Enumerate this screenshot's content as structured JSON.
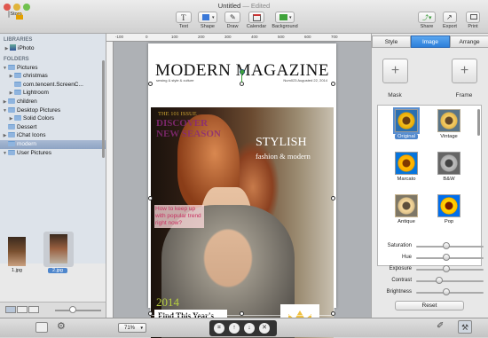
{
  "window": {
    "title": "Untitled",
    "edited": "— Edited"
  },
  "toolbar": {
    "store": "Store",
    "items": [
      "Text",
      "Shape",
      "Draw",
      "Calendar",
      "Background"
    ],
    "right": [
      "Share",
      "Export",
      "Print"
    ]
  },
  "sidebar": {
    "libraries_header": "LIBRARIES",
    "iphoto": "iPhoto",
    "folders_header": "FOLDERS",
    "folders": [
      "Pictures",
      "christmas",
      "com.tencent.ScreenC...",
      "Lightroom",
      "children",
      "Desktop Pictures",
      "Solid Colors",
      "Dessert",
      "iChat Icons",
      "modern",
      "User Pictures"
    ],
    "thumbs": [
      "1.jpg",
      "2.jpg"
    ]
  },
  "ruler": {
    "labels": [
      "-100",
      "0",
      "100",
      "200",
      "300",
      "400",
      "500",
      "600",
      "700"
    ]
  },
  "magazine": {
    "title": "MODERN MAGAZINE",
    "subtitle_left": "sewing & style & culture",
    "subtitle_right": "Num023 Augusted 22, 2014",
    "issue": "THE 101 ISSUE",
    "discover": "DISCOVER",
    "new_season": "NEW SEASON",
    "stylish": "STYLISH",
    "fashion": "fashion & modern",
    "keep_up": "How to keep up with popular trend right now?",
    "year": "2014",
    "find": "Find This Year's",
    "find_sub": "fashion products by yourselves and our guide"
  },
  "zoom": "71%",
  "panel": {
    "tabs": [
      "Style",
      "Image",
      "Arrange"
    ],
    "active_tab": "Image",
    "mask": "Mask",
    "frame": "Frame",
    "filters": [
      "Original",
      "Vintage",
      "Marcato",
      "B&W",
      "Antique",
      "Pop"
    ],
    "adjustments": [
      {
        "name": "Saturation",
        "value": 0.45
      },
      {
        "name": "Hue",
        "value": 0.45
      },
      {
        "name": "Exposure",
        "value": 0.45
      },
      {
        "name": "Contrast",
        "value": 0.35
      },
      {
        "name": "Brightness",
        "value": 0.45
      }
    ],
    "reset": "Reset"
  },
  "colors": {
    "accent": "#2d7fd9",
    "selection": "#8ea4c4"
  }
}
